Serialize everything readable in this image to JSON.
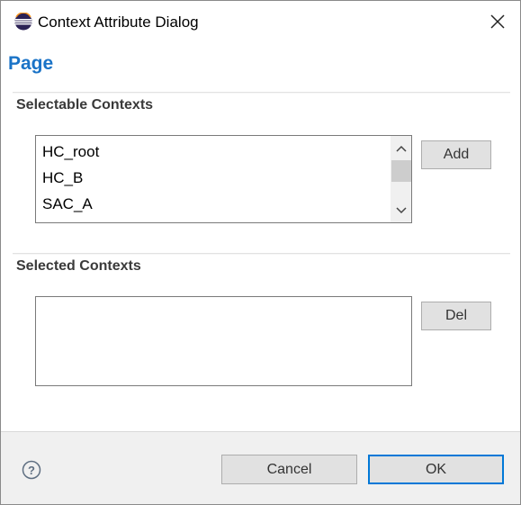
{
  "window": {
    "title": "Context Attribute Dialog",
    "app_icon": "eclipse-icon",
    "close_icon": "close-icon"
  },
  "page": {
    "heading": "Page"
  },
  "selectable": {
    "label": "Selectable Contexts",
    "items": [
      "HC_root",
      "HC_B",
      "SAC_A"
    ],
    "add_label": "Add",
    "scroll_up_icon": "chevron-up-icon",
    "scroll_down_icon": "chevron-down-icon"
  },
  "selected": {
    "label": "Selected Contexts",
    "items": [],
    "del_label": "Del"
  },
  "footer": {
    "help_icon": "help-icon",
    "cancel_label": "Cancel",
    "ok_label": "OK"
  },
  "colors": {
    "heading": "#1a73c7",
    "footer_bg": "#f0f0f0",
    "ok_border": "#0078d7",
    "button_bg": "#e1e1e1"
  }
}
